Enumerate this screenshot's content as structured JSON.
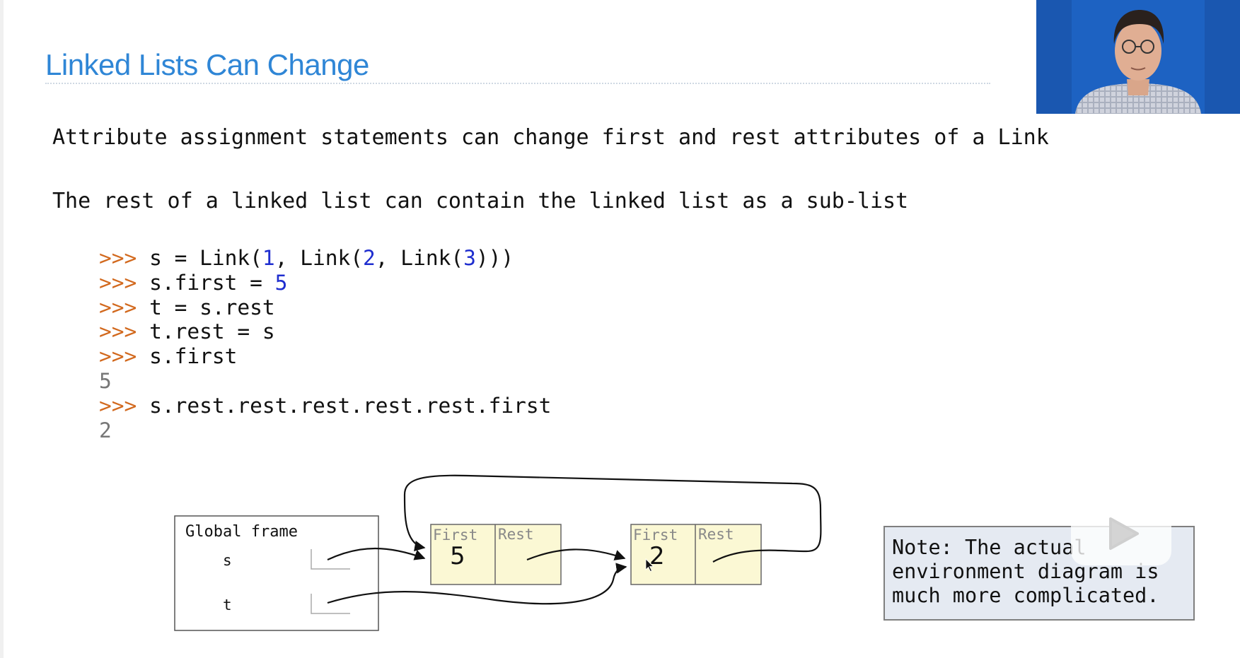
{
  "slide": {
    "title": "Linked Lists Can Change",
    "paragraph1": "Attribute assignment statements can change first and rest attributes of a Link",
    "paragraph2": "The rest of a linked list can contain the linked list as a sub-list"
  },
  "code": {
    "prompt": ">>>",
    "lines": [
      {
        "prefix": "s = Link(",
        "n1": "1",
        "mid1": ", Link(",
        "n2": "2",
        "mid2": ", Link(",
        "n3": "3",
        "suffix": ")))"
      },
      {
        "text": "s.first = ",
        "n": "5"
      },
      {
        "text": "t = s.rest"
      },
      {
        "text": "t.rest = s"
      },
      {
        "text": "s.first"
      },
      {
        "output": "5"
      },
      {
        "text": "s.rest.rest.rest.rest.rest.first"
      },
      {
        "output": "2"
      }
    ]
  },
  "diagram": {
    "frame_title": "Global frame",
    "var_s": "s",
    "var_t": "t",
    "link1": {
      "first_label": "First",
      "rest_label": "Rest",
      "first_value": "5"
    },
    "link2": {
      "first_label": "First",
      "rest_label": "Rest",
      "first_value": "2"
    }
  },
  "note": {
    "text": "Note: The actual\nenvironment diagram is\nmuch more complicated."
  },
  "icons": {
    "video": "presenter-video",
    "badge": "play-icon"
  }
}
